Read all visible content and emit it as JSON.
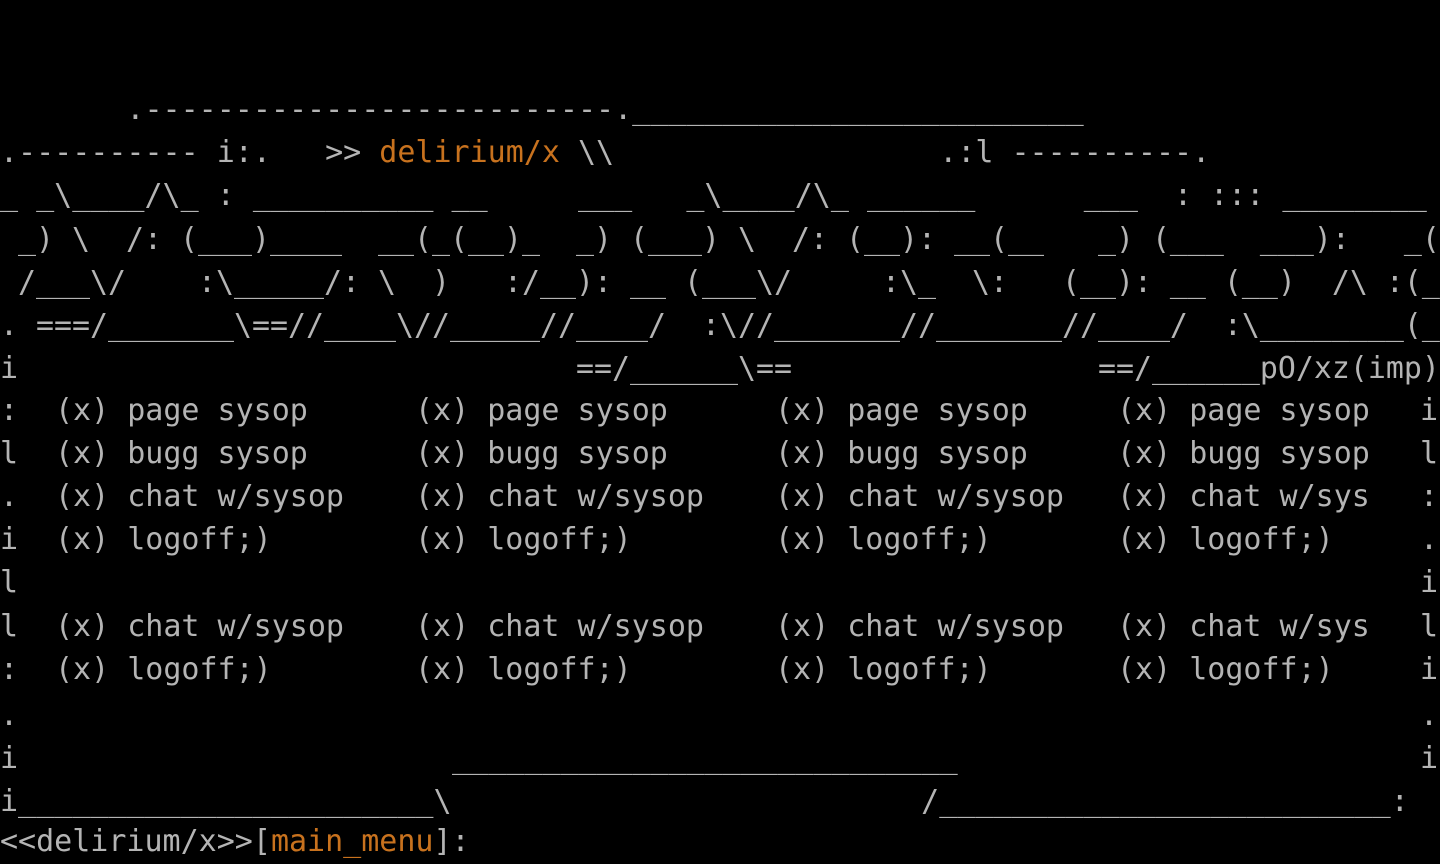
{
  "colors": {
    "background": "#000000",
    "text": "#b4b4b4",
    "accent": "#c8721e"
  },
  "banner": {
    "line1": "       .--------------------------.",
    "line1b": "_________________________",
    "line2_left": ".---------- i:.   >> ",
    "title": "delirium/x",
    "line2_mid": " \\\\",
    "line2_right": "                  .:l ----------.",
    "line3": "_ _\\____/\\_ : __________ __     ___   _\\____/\\_ ______      ___  : ::: ________",
    "line4": " _) \\  /: (___)____  __(_(__)_  _) (___) \\  /: (__): __(__   _) (___  ___):   _(",
    "line5": " /___\\/    :\\_____/: \\  )   :/__): __ (___\\/     :\\_  \\:   (__): __ (__)  /\\ :(_",
    "line6": ". ===/_______\\==//____\\//_____//____/  :\\//_______//_______//____/  :\\________(_",
    "line7": "i                               ==/______\\==                 ==/______pO/xz(imp)"
  },
  "menu": {
    "rows": [
      {
        "left": ":",
        "right": "i",
        "items": [
          "(x) page sysop",
          "(x) page sysop",
          "(x) page sysop",
          "(x) page sysop"
        ]
      },
      {
        "left": "l",
        "right": "l",
        "items": [
          "(x) bugg sysop",
          "(x) bugg sysop",
          "(x) bugg sysop",
          "(x) bugg sysop"
        ]
      },
      {
        "left": ".",
        "right": ":",
        "items": [
          "(x) chat w/sysop",
          "(x) chat w/sysop",
          "(x) chat w/sysop",
          "(x) chat w/sys"
        ]
      },
      {
        "left": "i",
        "right": ".",
        "items": [
          "(x) logoff;)",
          "(x) logoff;)",
          "(x) logoff;)",
          "(x) logoff;)"
        ]
      }
    ],
    "spacer_left": "l",
    "spacer_right": "i",
    "rows2": [
      {
        "left": "l",
        "right": "l",
        "items": [
          "(x) chat w/sysop",
          "(x) chat w/sysop",
          "(x) chat w/sysop",
          "(x) chat w/sys"
        ]
      },
      {
        "left": ":",
        "right": "i",
        "items": [
          "(x) logoff;)",
          "(x) logoff;)",
          "(x) logoff;)",
          "(x) logoff;)"
        ]
      }
    ]
  },
  "footer": {
    "line1_left": ".",
    "line1_right": ".",
    "line2_left": "i",
    "line2_mid": "____________________________",
    "line2_right": "i",
    "line3": "i_______________________\\                          /_________________________:"
  },
  "prompt": {
    "prefix": "<<delirium/x>>[",
    "section": "main_menu",
    "suffix": "]:"
  }
}
